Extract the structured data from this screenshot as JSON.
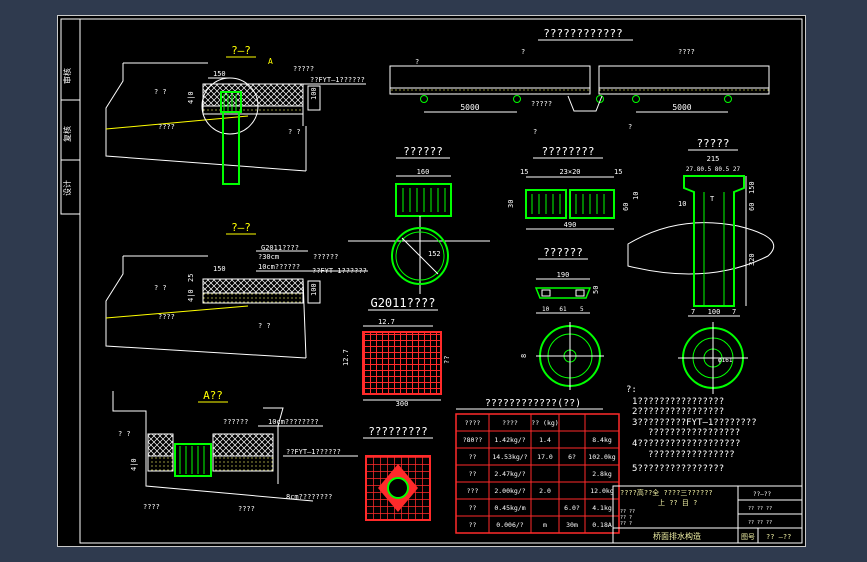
{
  "colors": {
    "line": "#ffffff",
    "yellow": "#ffff00",
    "green": "#00ff00",
    "red": "#ff2a2a",
    "cyan": "#00ffff",
    "pale": "#f2f2a6"
  },
  "side_tabs": [
    "审核",
    "复核",
    "设计"
  ],
  "sections": {
    "section_aa": {
      "title": "?—?",
      "tag": "A",
      "dim_150": "150",
      "label_1": "??FYT—1??????",
      "label_2": "?????",
      "label_3": "? ?",
      "label_4": "????",
      "label_5": "? ?",
      "dim_vert": "4|0",
      "dim_vert2": "100"
    },
    "section_bb": {
      "title": "?—?",
      "label_1": "G2011????",
      "label_2": "?30cm",
      "label_3": "??????",
      "label_4": "10cm??????",
      "label_5": "??FYT—1??????",
      "dim_150": "150",
      "dim_25": "25",
      "dim_vert": "4|0",
      "dim_100": "100",
      "label_6": "? ?",
      "label_7": "????",
      "label_8": "? ?"
    },
    "detail_a": {
      "title": "A??",
      "label_1": "??????",
      "label_2": "10cm????????",
      "label_3": "??FYT—1??????",
      "label_4": "8cm????????",
      "label_5": "? ?",
      "label_6": "????",
      "label_7": "????",
      "dim": "4|0"
    }
  },
  "top_right": {
    "title": "????????????",
    "label_1": "?",
    "label_2": "????",
    "label_3": "?",
    "label_4": "?????",
    "label_5": "?",
    "label_6": "?",
    "dim_1": "5000",
    "dim_2": "5000"
  },
  "grate_plan": {
    "title": "??????",
    "dim": "160"
  },
  "circle_grate": {
    "dim": "152"
  },
  "plate_detail": {
    "title": "????????",
    "dim_top": "23×20",
    "dim_15a": "15",
    "dim_15b": "15",
    "dim_bottom": "490",
    "dim_30": "30",
    "dim_60": "60",
    "dim_10": "10"
  },
  "pipe_detail": {
    "title": "?????",
    "dim_215": "215",
    "dim_sub": "27.80.5 80.5 27",
    "dim_10": "10",
    "dim_60": "60",
    "dim_150": "150",
    "dim_320": "320",
    "dim_7a": "7",
    "dim_100": "100",
    "dim_7b": "7",
    "label_t": "T"
  },
  "ring_detail": {
    "title": "??????",
    "dim_190": "190",
    "dim_50": "50",
    "dim_10": "10",
    "dim_61": "61",
    "dim_5": "5"
  },
  "grid_g2011": {
    "title": "G2011????",
    "dim_12_7": "12.7",
    "dim_side": "12.7",
    "dim_300": "300",
    "label_q": "??"
  },
  "grid_small": {
    "title": "?????????"
  },
  "circle_plan_left": {
    "label": "8"
  },
  "circle_plan_right": {
    "label": "φ161"
  },
  "notes": {
    "header": "?:",
    "lines": [
      "1????????????????",
      "2????????????????",
      "3?????????FYT—1????????",
      "?????????????????",
      "4???????????????????",
      "????????????????",
      "5????????????????"
    ]
  },
  "materials_table": {
    "title": "????????????(??)",
    "headers": [
      "????",
      "????",
      "?? (kg)",
      "",
      ""
    ],
    "rows": [
      [
        "?80??",
        "1.42kg/?",
        "1.4",
        "",
        "8.4kg"
      ],
      [
        "??",
        "14.53kg/?",
        "17.0",
        "6?",
        "102.0kg"
      ],
      [
        "??",
        "2.47kg/?",
        "",
        "",
        "2.8kg"
      ],
      [
        "???",
        "2.00kg/?",
        "2.0",
        "",
        "12.0kg"
      ],
      [
        "??",
        "0.45kg/m",
        "",
        "6.0?",
        "4.1kg"
      ],
      [
        "??",
        "0.006/?",
        "m",
        "30m",
        "0.18A"
      ]
    ]
  },
  "title_block": {
    "line1": "????高??全 ????三??????",
    "line2": "上 ?? 目 ?",
    "left_1": "?? ??",
    "left_2": "?? ?",
    "left_3": "?? ?",
    "right_1": "??—??",
    "right_2": "?? ?? ??",
    "right_3": "?? ?? ??",
    "drawing_name": "桥面排水构造",
    "sheet_no_label": "图号",
    "sheet_no": "?? —??"
  }
}
